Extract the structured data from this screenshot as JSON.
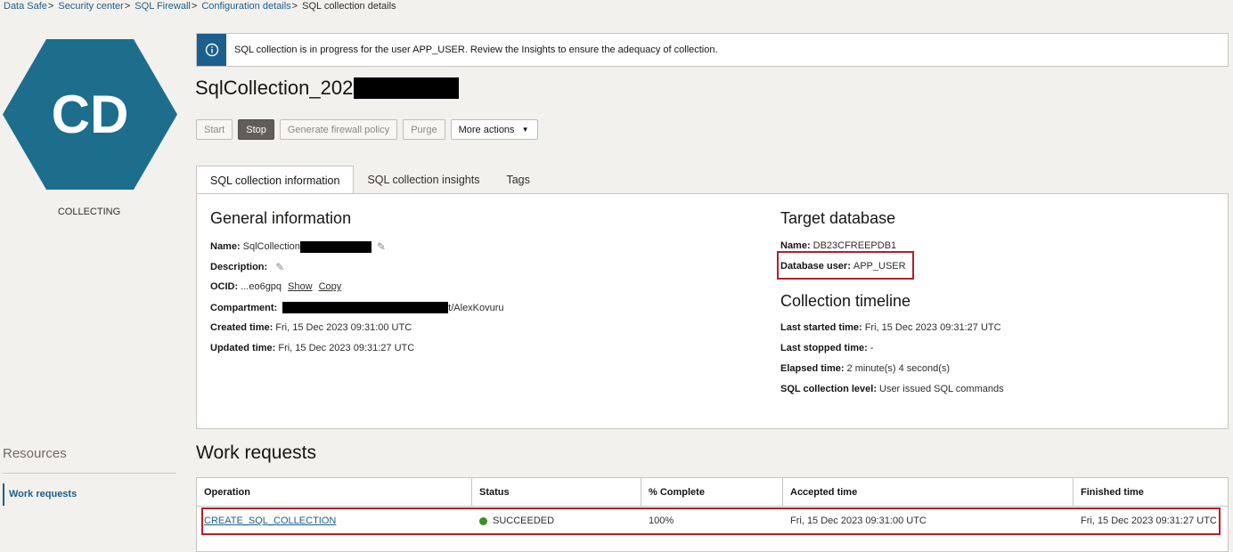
{
  "breadcrumb": {
    "items": [
      "Data Safe",
      "Security center",
      "SQL Firewall",
      "Configuration details"
    ],
    "current": "SQL collection details"
  },
  "hexagon": {
    "initials": "CD",
    "status": "COLLECTING",
    "color": "#1c6e8c"
  },
  "resources": {
    "title": "Resources",
    "items": [
      "Work requests"
    ]
  },
  "banner": {
    "text": "SQL collection is in progress for the user APP_USER. Review the Insights to ensure the adequacy of collection.",
    "icon": "info-icon"
  },
  "page": {
    "title": "SqlCollection_202"
  },
  "actions": {
    "start": "Start",
    "stop": "Stop",
    "generate": "Generate firewall policy",
    "purge": "Purge",
    "more": "More actions"
  },
  "tabs": [
    "SQL collection information",
    "SQL collection insights",
    "Tags"
  ],
  "general": {
    "title": "General information",
    "name_label": "Name:",
    "name_value": "SqlCollection",
    "description_label": "Description:",
    "ocid_label": "OCID:",
    "ocid_value": "...eo6gpq",
    "show": "Show",
    "copy": "Copy",
    "compartment_label": "Compartment:",
    "compartment_value": "t/AlexKovuru",
    "created_label": "Created time:",
    "created_value": "Fri, 15 Dec 2023 09:31:00 UTC",
    "updated_label": "Updated time:",
    "updated_value": "Fri, 15 Dec 2023 09:31:27 UTC"
  },
  "target": {
    "title": "Target database",
    "name_label": "Name:",
    "name_value": "DB23CFREEPDB1",
    "user_label": "Database user:",
    "user_value": "APP_USER"
  },
  "timeline": {
    "title": "Collection timeline",
    "started_label": "Last started time:",
    "started_value": "Fri, 15 Dec 2023 09:31:27 UTC",
    "stopped_label": "Last stopped time:",
    "stopped_value": "-",
    "elapsed_label": "Elapsed time:",
    "elapsed_value": "2 minute(s) 4 second(s)",
    "level_label": "SQL collection level:",
    "level_value": "User issued SQL commands"
  },
  "work_requests": {
    "title": "Work requests",
    "columns": [
      "Operation",
      "Status",
      "% Complete",
      "Accepted time",
      "Finished time"
    ],
    "rows": [
      {
        "operation": "CREATE_SQL_COLLECTION",
        "status": "SUCCEEDED",
        "complete": "100%",
        "accepted": "Fri, 15 Dec 2023 09:31:00 UTC",
        "finished": "Fri, 15 Dec 2023 09:31:27 UTC"
      }
    ]
  }
}
